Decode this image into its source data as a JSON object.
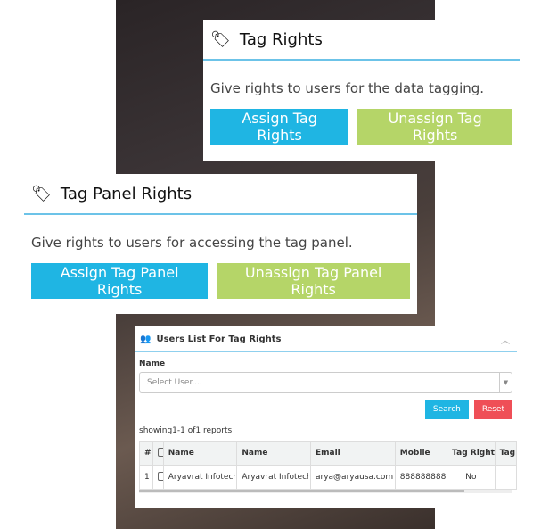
{
  "tag_rights": {
    "title": "Tag Rights",
    "description": "Give rights to users for the data tagging.",
    "assign": "Assign Tag Rights",
    "unassign": "Unassign Tag Rights"
  },
  "tag_panel_rights": {
    "title": "Tag Panel Rights",
    "description": "Give rights to users for accessing the tag panel.",
    "assign": "Assign Tag Panel Rights",
    "unassign": "Unassign Tag Panel Rights"
  },
  "users_list": {
    "title": "Users List For Tag Rights",
    "name_label": "Name",
    "select_placeholder": "Select User....",
    "search": "Search",
    "reset": "Reset",
    "showing": "showing1-1 of1 reports",
    "columns": [
      "#",
      "",
      "Name",
      "Name",
      "Email",
      "Mobile",
      "Tag Rights",
      "Tag Panel Rights"
    ],
    "rows": [
      {
        "num": "1",
        "name1": "Aryavrat Infotech",
        "name2": "Aryavrat Infotech",
        "email": "arya@aryausa.com",
        "mobile": "8888888888",
        "tag_rights": "No",
        "tag_panel": ""
      }
    ]
  },
  "colors": {
    "blue": "#1fb5e3",
    "green": "#b5d568",
    "red": "#ef4f57"
  }
}
